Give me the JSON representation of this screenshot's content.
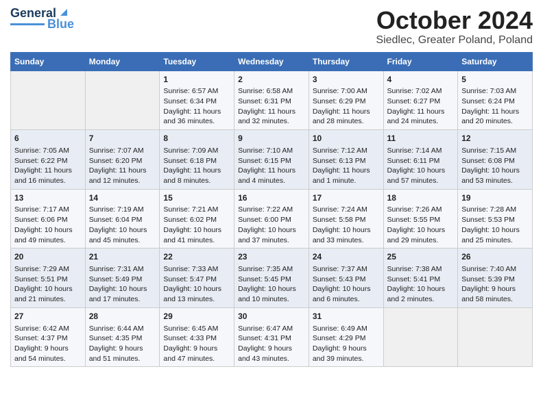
{
  "logo": {
    "line1": "General",
    "line2": "Blue"
  },
  "title": "October 2024",
  "subtitle": "Siedlec, Greater Poland, Poland",
  "days_of_week": [
    "Sunday",
    "Monday",
    "Tuesday",
    "Wednesday",
    "Thursday",
    "Friday",
    "Saturday"
  ],
  "weeks": [
    [
      {
        "day": "",
        "content": ""
      },
      {
        "day": "",
        "content": ""
      },
      {
        "day": "1",
        "content": "Sunrise: 6:57 AM\nSunset: 6:34 PM\nDaylight: 11 hours\nand 36 minutes."
      },
      {
        "day": "2",
        "content": "Sunrise: 6:58 AM\nSunset: 6:31 PM\nDaylight: 11 hours\nand 32 minutes."
      },
      {
        "day": "3",
        "content": "Sunrise: 7:00 AM\nSunset: 6:29 PM\nDaylight: 11 hours\nand 28 minutes."
      },
      {
        "day": "4",
        "content": "Sunrise: 7:02 AM\nSunset: 6:27 PM\nDaylight: 11 hours\nand 24 minutes."
      },
      {
        "day": "5",
        "content": "Sunrise: 7:03 AM\nSunset: 6:24 PM\nDaylight: 11 hours\nand 20 minutes."
      }
    ],
    [
      {
        "day": "6",
        "content": "Sunrise: 7:05 AM\nSunset: 6:22 PM\nDaylight: 11 hours\nand 16 minutes."
      },
      {
        "day": "7",
        "content": "Sunrise: 7:07 AM\nSunset: 6:20 PM\nDaylight: 11 hours\nand 12 minutes."
      },
      {
        "day": "8",
        "content": "Sunrise: 7:09 AM\nSunset: 6:18 PM\nDaylight: 11 hours\nand 8 minutes."
      },
      {
        "day": "9",
        "content": "Sunrise: 7:10 AM\nSunset: 6:15 PM\nDaylight: 11 hours\nand 4 minutes."
      },
      {
        "day": "10",
        "content": "Sunrise: 7:12 AM\nSunset: 6:13 PM\nDaylight: 11 hours\nand 1 minute."
      },
      {
        "day": "11",
        "content": "Sunrise: 7:14 AM\nSunset: 6:11 PM\nDaylight: 10 hours\nand 57 minutes."
      },
      {
        "day": "12",
        "content": "Sunrise: 7:15 AM\nSunset: 6:08 PM\nDaylight: 10 hours\nand 53 minutes."
      }
    ],
    [
      {
        "day": "13",
        "content": "Sunrise: 7:17 AM\nSunset: 6:06 PM\nDaylight: 10 hours\nand 49 minutes."
      },
      {
        "day": "14",
        "content": "Sunrise: 7:19 AM\nSunset: 6:04 PM\nDaylight: 10 hours\nand 45 minutes."
      },
      {
        "day": "15",
        "content": "Sunrise: 7:21 AM\nSunset: 6:02 PM\nDaylight: 10 hours\nand 41 minutes."
      },
      {
        "day": "16",
        "content": "Sunrise: 7:22 AM\nSunset: 6:00 PM\nDaylight: 10 hours\nand 37 minutes."
      },
      {
        "day": "17",
        "content": "Sunrise: 7:24 AM\nSunset: 5:58 PM\nDaylight: 10 hours\nand 33 minutes."
      },
      {
        "day": "18",
        "content": "Sunrise: 7:26 AM\nSunset: 5:55 PM\nDaylight: 10 hours\nand 29 minutes."
      },
      {
        "day": "19",
        "content": "Sunrise: 7:28 AM\nSunset: 5:53 PM\nDaylight: 10 hours\nand 25 minutes."
      }
    ],
    [
      {
        "day": "20",
        "content": "Sunrise: 7:29 AM\nSunset: 5:51 PM\nDaylight: 10 hours\nand 21 minutes."
      },
      {
        "day": "21",
        "content": "Sunrise: 7:31 AM\nSunset: 5:49 PM\nDaylight: 10 hours\nand 17 minutes."
      },
      {
        "day": "22",
        "content": "Sunrise: 7:33 AM\nSunset: 5:47 PM\nDaylight: 10 hours\nand 13 minutes."
      },
      {
        "day": "23",
        "content": "Sunrise: 7:35 AM\nSunset: 5:45 PM\nDaylight: 10 hours\nand 10 minutes."
      },
      {
        "day": "24",
        "content": "Sunrise: 7:37 AM\nSunset: 5:43 PM\nDaylight: 10 hours\nand 6 minutes."
      },
      {
        "day": "25",
        "content": "Sunrise: 7:38 AM\nSunset: 5:41 PM\nDaylight: 10 hours\nand 2 minutes."
      },
      {
        "day": "26",
        "content": "Sunrise: 7:40 AM\nSunset: 5:39 PM\nDaylight: 9 hours\nand 58 minutes."
      }
    ],
    [
      {
        "day": "27",
        "content": "Sunrise: 6:42 AM\nSunset: 4:37 PM\nDaylight: 9 hours\nand 54 minutes."
      },
      {
        "day": "28",
        "content": "Sunrise: 6:44 AM\nSunset: 4:35 PM\nDaylight: 9 hours\nand 51 minutes."
      },
      {
        "day": "29",
        "content": "Sunrise: 6:45 AM\nSunset: 4:33 PM\nDaylight: 9 hours\nand 47 minutes."
      },
      {
        "day": "30",
        "content": "Sunrise: 6:47 AM\nSunset: 4:31 PM\nDaylight: 9 hours\nand 43 minutes."
      },
      {
        "day": "31",
        "content": "Sunrise: 6:49 AM\nSunset: 4:29 PM\nDaylight: 9 hours\nand 39 minutes."
      },
      {
        "day": "",
        "content": ""
      },
      {
        "day": "",
        "content": ""
      }
    ]
  ]
}
